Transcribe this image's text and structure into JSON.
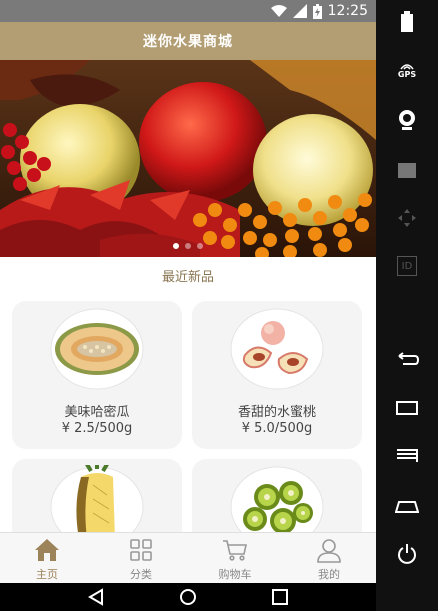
{
  "status_bar": {
    "time": "12:25"
  },
  "app_bar": {
    "title": "迷你水果商城"
  },
  "banner": {
    "slide_count": 3,
    "active_index": 0
  },
  "section": {
    "title": "最近新品"
  },
  "products": [
    {
      "name": "美味哈密瓜",
      "price": "¥ 2.5/500g",
      "icon": "melon"
    },
    {
      "name": "香甜的水蜜桃",
      "price": "¥ 5.0/500g",
      "icon": "peach"
    },
    {
      "name": "",
      "price": "",
      "icon": "pineapple"
    },
    {
      "name": "",
      "price": "",
      "icon": "kiwi"
    }
  ],
  "tabs": [
    {
      "label": "主页",
      "icon": "home-icon",
      "active": true
    },
    {
      "label": "分类",
      "icon": "grid-icon",
      "active": false
    },
    {
      "label": "购物车",
      "icon": "cart-icon",
      "active": false
    },
    {
      "label": "我的",
      "icon": "user-icon",
      "active": false
    }
  ],
  "side_panel": {
    "gps_label": "GPS",
    "id_label": "ID"
  },
  "colors": {
    "accent": "#b39e74",
    "tab_active": "#9c835a"
  }
}
